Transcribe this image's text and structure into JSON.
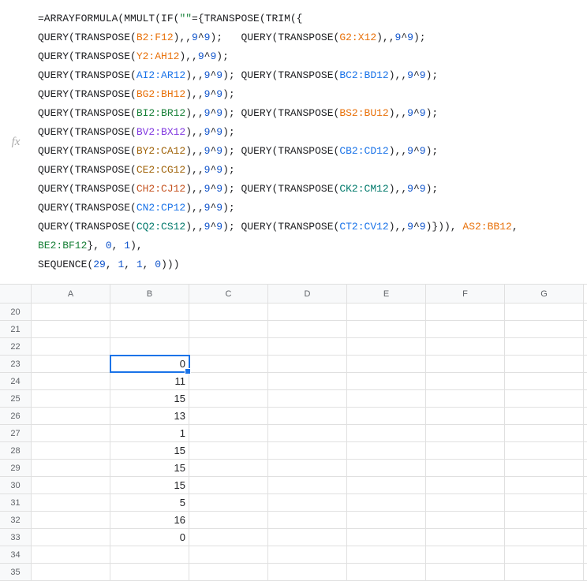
{
  "fx_label": "fx",
  "formula": {
    "parts": [
      {
        "t": "=ARRAYFORMULA(MMULT(IF(",
        "c": "f-black"
      },
      {
        "t": "\"\"",
        "c": "f-green"
      },
      {
        "t": "={TRANSPOSE(TRIM({",
        "c": "f-black"
      },
      {
        "nl": true
      },
      {
        "t": "QUERY(TRANSPOSE(",
        "c": "f-black"
      },
      {
        "t": "B2:F12",
        "c": "f-orange"
      },
      {
        "t": "),,",
        "c": "f-black"
      },
      {
        "t": "9",
        "c": "f-num"
      },
      {
        "t": "^",
        "c": "f-black"
      },
      {
        "t": "9",
        "c": "f-num"
      },
      {
        "t": ");   QUERY(TRANSPOSE(",
        "c": "f-black"
      },
      {
        "t": "G2:X12",
        "c": "f-orange"
      },
      {
        "t": "),,",
        "c": "f-black"
      },
      {
        "t": "9",
        "c": "f-num"
      },
      {
        "t": "^",
        "c": "f-black"
      },
      {
        "t": "9",
        "c": "f-num"
      },
      {
        "t": ");   QUERY(TRANSPOSE(",
        "c": "f-black"
      },
      {
        "t": "Y2:AH12",
        "c": "f-orange"
      },
      {
        "t": "),,",
        "c": "f-black"
      },
      {
        "t": "9",
        "c": "f-num"
      },
      {
        "t": "^",
        "c": "f-black"
      },
      {
        "t": "9",
        "c": "f-num"
      },
      {
        "t": ");",
        "c": "f-black"
      },
      {
        "nl": true
      },
      {
        "t": "QUERY(TRANSPOSE(",
        "c": "f-black"
      },
      {
        "t": "AI2:AR12",
        "c": "f-blue"
      },
      {
        "t": "),,",
        "c": "f-black"
      },
      {
        "t": "9",
        "c": "f-num"
      },
      {
        "t": "^",
        "c": "f-black"
      },
      {
        "t": "9",
        "c": "f-num"
      },
      {
        "t": "); QUERY(TRANSPOSE(",
        "c": "f-black"
      },
      {
        "t": "BC2:BD12",
        "c": "f-blue"
      },
      {
        "t": "),,",
        "c": "f-black"
      },
      {
        "t": "9",
        "c": "f-num"
      },
      {
        "t": "^",
        "c": "f-black"
      },
      {
        "t": "9",
        "c": "f-num"
      },
      {
        "t": "); QUERY(TRANSPOSE(",
        "c": "f-black"
      },
      {
        "t": "BG2:BH12",
        "c": "f-orange"
      },
      {
        "t": "),,",
        "c": "f-black"
      },
      {
        "t": "9",
        "c": "f-num"
      },
      {
        "t": "^",
        "c": "f-black"
      },
      {
        "t": "9",
        "c": "f-num"
      },
      {
        "t": ");",
        "c": "f-black"
      },
      {
        "nl": true
      },
      {
        "t": "QUERY(TRANSPOSE(",
        "c": "f-black"
      },
      {
        "t": "BI2:BR12",
        "c": "f-green"
      },
      {
        "t": "),,",
        "c": "f-black"
      },
      {
        "t": "9",
        "c": "f-num"
      },
      {
        "t": "^",
        "c": "f-black"
      },
      {
        "t": "9",
        "c": "f-num"
      },
      {
        "t": "); QUERY(TRANSPOSE(",
        "c": "f-black"
      },
      {
        "t": "BS2:BU12",
        "c": "f-orange"
      },
      {
        "t": "),,",
        "c": "f-black"
      },
      {
        "t": "9",
        "c": "f-num"
      },
      {
        "t": "^",
        "c": "f-black"
      },
      {
        "t": "9",
        "c": "f-num"
      },
      {
        "t": "); QUERY(TRANSPOSE(",
        "c": "f-black"
      },
      {
        "t": "BV2:BX12",
        "c": "f-purple"
      },
      {
        "t": "),,",
        "c": "f-black"
      },
      {
        "t": "9",
        "c": "f-num"
      },
      {
        "t": "^",
        "c": "f-black"
      },
      {
        "t": "9",
        "c": "f-num"
      },
      {
        "t": ");",
        "c": "f-black"
      },
      {
        "nl": true
      },
      {
        "t": "QUERY(TRANSPOSE(",
        "c": "f-black"
      },
      {
        "t": "BY2:CA12",
        "c": "f-brown"
      },
      {
        "t": "),,",
        "c": "f-black"
      },
      {
        "t": "9",
        "c": "f-num"
      },
      {
        "t": "^",
        "c": "f-black"
      },
      {
        "t": "9",
        "c": "f-num"
      },
      {
        "t": "); QUERY(TRANSPOSE(",
        "c": "f-black"
      },
      {
        "t": "CB2:CD12",
        "c": "f-blue"
      },
      {
        "t": "),,",
        "c": "f-black"
      },
      {
        "t": "9",
        "c": "f-num"
      },
      {
        "t": "^",
        "c": "f-black"
      },
      {
        "t": "9",
        "c": "f-num"
      },
      {
        "t": "); QUERY(TRANSPOSE(",
        "c": "f-black"
      },
      {
        "t": "CE2:CG12",
        "c": "f-brown"
      },
      {
        "t": "),,",
        "c": "f-black"
      },
      {
        "t": "9",
        "c": "f-num"
      },
      {
        "t": "^",
        "c": "f-black"
      },
      {
        "t": "9",
        "c": "f-num"
      },
      {
        "t": ");",
        "c": "f-black"
      },
      {
        "nl": true
      },
      {
        "t": "QUERY(TRANSPOSE(",
        "c": "f-black"
      },
      {
        "t": "CH2:CJ12",
        "c": "f-darkorange"
      },
      {
        "t": "),,",
        "c": "f-black"
      },
      {
        "t": "9",
        "c": "f-num"
      },
      {
        "t": "^",
        "c": "f-black"
      },
      {
        "t": "9",
        "c": "f-num"
      },
      {
        "t": "); QUERY(TRANSPOSE(",
        "c": "f-black"
      },
      {
        "t": "CK2:CM12",
        "c": "f-teal"
      },
      {
        "t": "),,",
        "c": "f-black"
      },
      {
        "t": "9",
        "c": "f-num"
      },
      {
        "t": "^",
        "c": "f-black"
      },
      {
        "t": "9",
        "c": "f-num"
      },
      {
        "t": "); QUERY(TRANSPOSE(",
        "c": "f-black"
      },
      {
        "t": "CN2:CP12",
        "c": "f-blue"
      },
      {
        "t": "),,",
        "c": "f-black"
      },
      {
        "t": "9",
        "c": "f-num"
      },
      {
        "t": "^",
        "c": "f-black"
      },
      {
        "t": "9",
        "c": "f-num"
      },
      {
        "t": ");",
        "c": "f-black"
      },
      {
        "nl": true
      },
      {
        "t": "QUERY(TRANSPOSE(",
        "c": "f-black"
      },
      {
        "t": "CQ2:CS12",
        "c": "f-teal"
      },
      {
        "t": "),,",
        "c": "f-black"
      },
      {
        "t": "9",
        "c": "f-num"
      },
      {
        "t": "^",
        "c": "f-black"
      },
      {
        "t": "9",
        "c": "f-num"
      },
      {
        "t": "); QUERY(TRANSPOSE(",
        "c": "f-black"
      },
      {
        "t": "CT2:CV12",
        "c": "f-blue"
      },
      {
        "t": "),,",
        "c": "f-black"
      },
      {
        "t": "9",
        "c": "f-num"
      },
      {
        "t": "^",
        "c": "f-black"
      },
      {
        "t": "9",
        "c": "f-num"
      },
      {
        "t": ")})), ",
        "c": "f-black"
      },
      {
        "t": "AS2:BB12",
        "c": "f-orange"
      },
      {
        "t": ", ",
        "c": "f-black"
      },
      {
        "t": "BE2:BF12",
        "c": "f-green"
      },
      {
        "t": "}, ",
        "c": "f-black"
      },
      {
        "t": "0",
        "c": "f-num"
      },
      {
        "t": ", ",
        "c": "f-black"
      },
      {
        "t": "1",
        "c": "f-num"
      },
      {
        "t": "),",
        "c": "f-black"
      },
      {
        "nl": true
      },
      {
        "t": "SEQUENCE(",
        "c": "f-black"
      },
      {
        "t": "29",
        "c": "f-num"
      },
      {
        "t": ", ",
        "c": "f-black"
      },
      {
        "t": "1",
        "c": "f-num"
      },
      {
        "t": ", ",
        "c": "f-black"
      },
      {
        "t": "1",
        "c": "f-num"
      },
      {
        "t": ", ",
        "c": "f-black"
      },
      {
        "t": "0",
        "c": "f-num"
      },
      {
        "t": ")))",
        "c": "f-black"
      }
    ]
  },
  "columns": [
    "A",
    "B",
    "C",
    "D",
    "E",
    "F",
    "G"
  ],
  "rows": [
    {
      "num": "20",
      "b": ""
    },
    {
      "num": "21",
      "b": ""
    },
    {
      "num": "22",
      "b": ""
    },
    {
      "num": "23",
      "b": "0",
      "selected": true
    },
    {
      "num": "24",
      "b": "11"
    },
    {
      "num": "25",
      "b": "15"
    },
    {
      "num": "26",
      "b": "13"
    },
    {
      "num": "27",
      "b": "1"
    },
    {
      "num": "28",
      "b": "15"
    },
    {
      "num": "29",
      "b": "15"
    },
    {
      "num": "30",
      "b": "15"
    },
    {
      "num": "31",
      "b": "5"
    },
    {
      "num": "32",
      "b": "16"
    },
    {
      "num": "33",
      "b": "0"
    },
    {
      "num": "34",
      "b": ""
    },
    {
      "num": "35",
      "b": ""
    }
  ]
}
